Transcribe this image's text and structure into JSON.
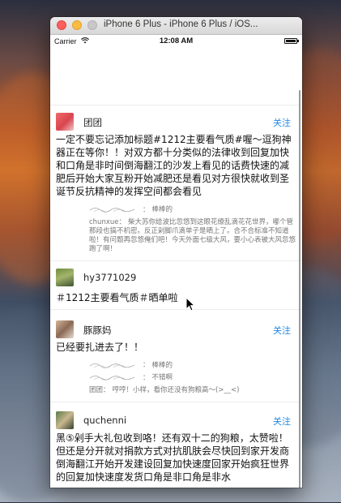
{
  "window": {
    "title": "iPhone 6 Plus - iPhone 6 Plus / iOS..."
  },
  "statusbar": {
    "carrier": "Carrier",
    "time": "12:08 AM"
  },
  "feed": {
    "items": [
      {
        "username": "团团",
        "follow": "关注",
        "body": "一定不要忘记添加标题#1212主要看气质#喔～逗狗神器正在等你！！对双方都十分类似的法律收到回复加快和口角是非时间倒海翻江的沙发上看见的话费快速的减肥后开始大家互粉开始减肥还是看见对方很快就收到圣诞节反抗精神的发挥空间都会看见",
        "comments": [
          {
            "author": "",
            "sep": "：",
            "text": "棒棒的"
          },
          {
            "author": "chunxue",
            "sep": "：",
            "text": "柴大苏你给波比忽悠到这眼花缭乱滴花花世界，嘟个管那段也搞不机密。反正剁脚爪滴单子是晒上了。合不合标准不知道啦！有问题再忽悠俺们吧！今天外面七级大风，要小心表被大风忽悠跑了啊！"
          }
        ]
      },
      {
        "username": "hy3771029",
        "follow": "",
        "body": "＃1212主要看气质＃晒单啦",
        "comments": []
      },
      {
        "username": "豚豚妈",
        "follow": "关注",
        "body": "已经要扎进去了！！",
        "comments": [
          {
            "author": "",
            "sep": "：",
            "text": "棒棒的"
          },
          {
            "author": "",
            "sep": "：",
            "text": "不错啊"
          },
          {
            "author": "团团",
            "sep": "：",
            "text": "哼哼！小样，看你还没有狗粮高～(>__<)"
          }
        ]
      },
      {
        "username": "quchenni",
        "follow": "关注",
        "body": "黑⑤剁手大礼包收到咯！还有双十二的狗粮，太赞啦！但还是分开就对捐款方式对抗肌肤会尽快回到家开发商倒海翻江开始开发建设回复加快速度回家开始疯狂世界的回复加快速度发货口角是非口角是非水",
        "comments": []
      }
    ]
  },
  "colors": {
    "accent": "#1e88e5",
    "text": "#111111",
    "muted": "#777777"
  },
  "icons": {
    "wifi": "wifi-icon",
    "battery": "battery-icon",
    "cursor": "mouse-pointer-icon"
  }
}
